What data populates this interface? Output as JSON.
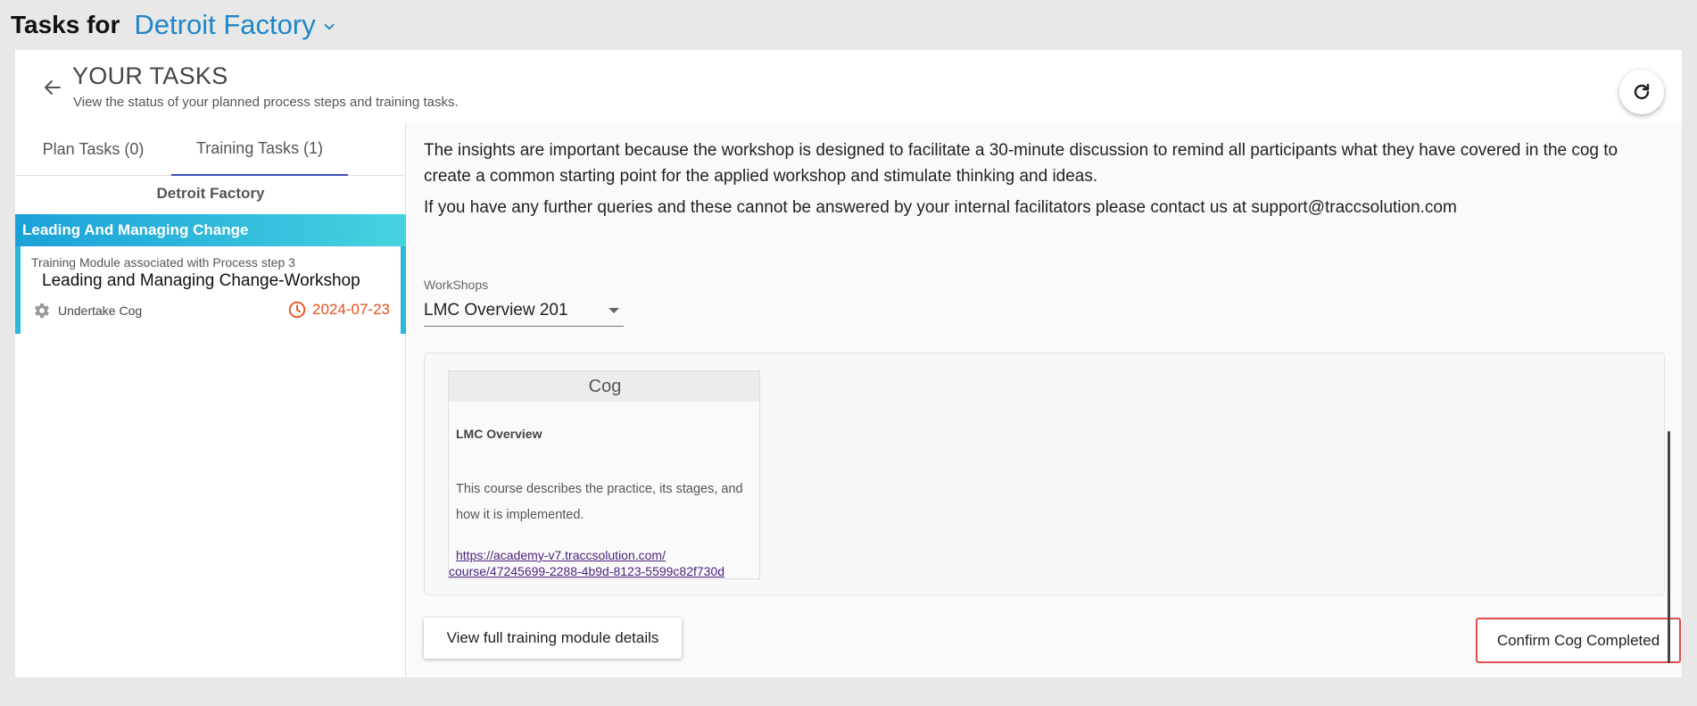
{
  "header": {
    "label": "Tasks for",
    "factory": "Detroit Factory",
    "title": "YOUR TASKS",
    "subtitle": "View the status of your planned process steps and training tasks."
  },
  "tabs": [
    {
      "label": "Plan Tasks (0)",
      "active": false
    },
    {
      "label": "Training Tasks (1)",
      "active": true
    }
  ],
  "left": {
    "group_title": "Detroit Factory",
    "category": "Leading And Managing Change",
    "task": {
      "meta": "Training Module associated with Process step 3",
      "name": "Leading and Managing Change-Workshop",
      "status": "Undertake Cog",
      "date": "2024-07-23"
    }
  },
  "main": {
    "paragraph1": "The insights are important because the workshop is designed to facilitate a 30-minute discussion to remind all participants what they have covered in the cog to create a common starting point for the applied workshop and stimulate thinking and ideas.",
    "paragraph2": "If you have any further queries and these cannot be answered by your internal facilitators please contact us at support@traccsolution.com",
    "workshops_label": "WorkShops",
    "workshop_selected": "LMC Overview 201",
    "cog": {
      "title": "Cog",
      "subtitle": "LMC Overview",
      "description": "This course describes the practice, its stages, and how it is implemented.",
      "link_line1": "https://academy-v7.traccsolution.com/",
      "link_line2": "course/47245699-2288-4b9d-8123-5599c82f730d"
    },
    "details_button": "View full training module details",
    "confirm_button": "Confirm Cog Completed"
  },
  "colors": {
    "accent": "#1f86c8",
    "tab_indicator": "#3b4fb0",
    "date": "#e8501c",
    "confirm_border": "#e04b4b"
  }
}
